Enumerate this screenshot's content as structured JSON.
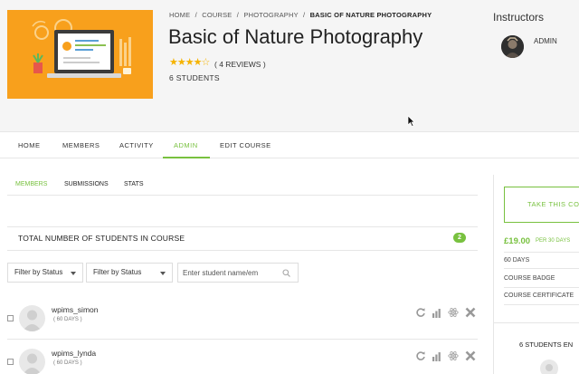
{
  "breadcrumb": {
    "items": [
      "HOME",
      "COURSE",
      "PHOTOGRAPHY"
    ],
    "separator": "/",
    "current": "BASIC OF NATURE PHOTOGRAPHY"
  },
  "course": {
    "title": "Basic of Nature Photography",
    "rating": 4,
    "rating_max": 5,
    "stars_text": "★★★★☆",
    "reviews": "( 4 REVIEWS )",
    "students": "6 STUDENTS"
  },
  "instructors": {
    "heading": "Instructors",
    "name": "ADMIN"
  },
  "tabs": [
    {
      "label": "HOME"
    },
    {
      "label": "MEMBERS"
    },
    {
      "label": "ACTIVITY"
    },
    {
      "label": "ADMIN",
      "active": true
    },
    {
      "label": "EDIT COURSE"
    }
  ],
  "subtabs": [
    {
      "label": "MEMBERS",
      "active": true
    },
    {
      "label": "SUBMISSIONS"
    },
    {
      "label": "STATS"
    }
  ],
  "total": {
    "label": "TOTAL NUMBER OF STUDENTS IN COURSE",
    "count": "2"
  },
  "filters": {
    "filter1": "Filter by Status",
    "filter2": "Filter by Status",
    "search_placeholder": "Enter student name/em"
  },
  "members": [
    {
      "name": "wpims_simon",
      "days": "( 60 DAYS )"
    },
    {
      "name": "wpims_lynda",
      "days": "( 60 DAYS )"
    }
  ],
  "member_actions": [
    "reset-icon",
    "stats-icon",
    "atom-icon",
    "remove-icon"
  ],
  "panel": {
    "button": "TAKE THIS CO",
    "price": "£19.00",
    "per": "PER 30 DAYS",
    "info": [
      "60 DAYS",
      "COURSE BADGE",
      "COURSE CERTIFICATE"
    ],
    "students_enrolled": "6 STUDENTS EN"
  },
  "colors": {
    "accent": "#78c13f",
    "thumbnail": "#f8a01c",
    "stars": "#f5b301"
  }
}
